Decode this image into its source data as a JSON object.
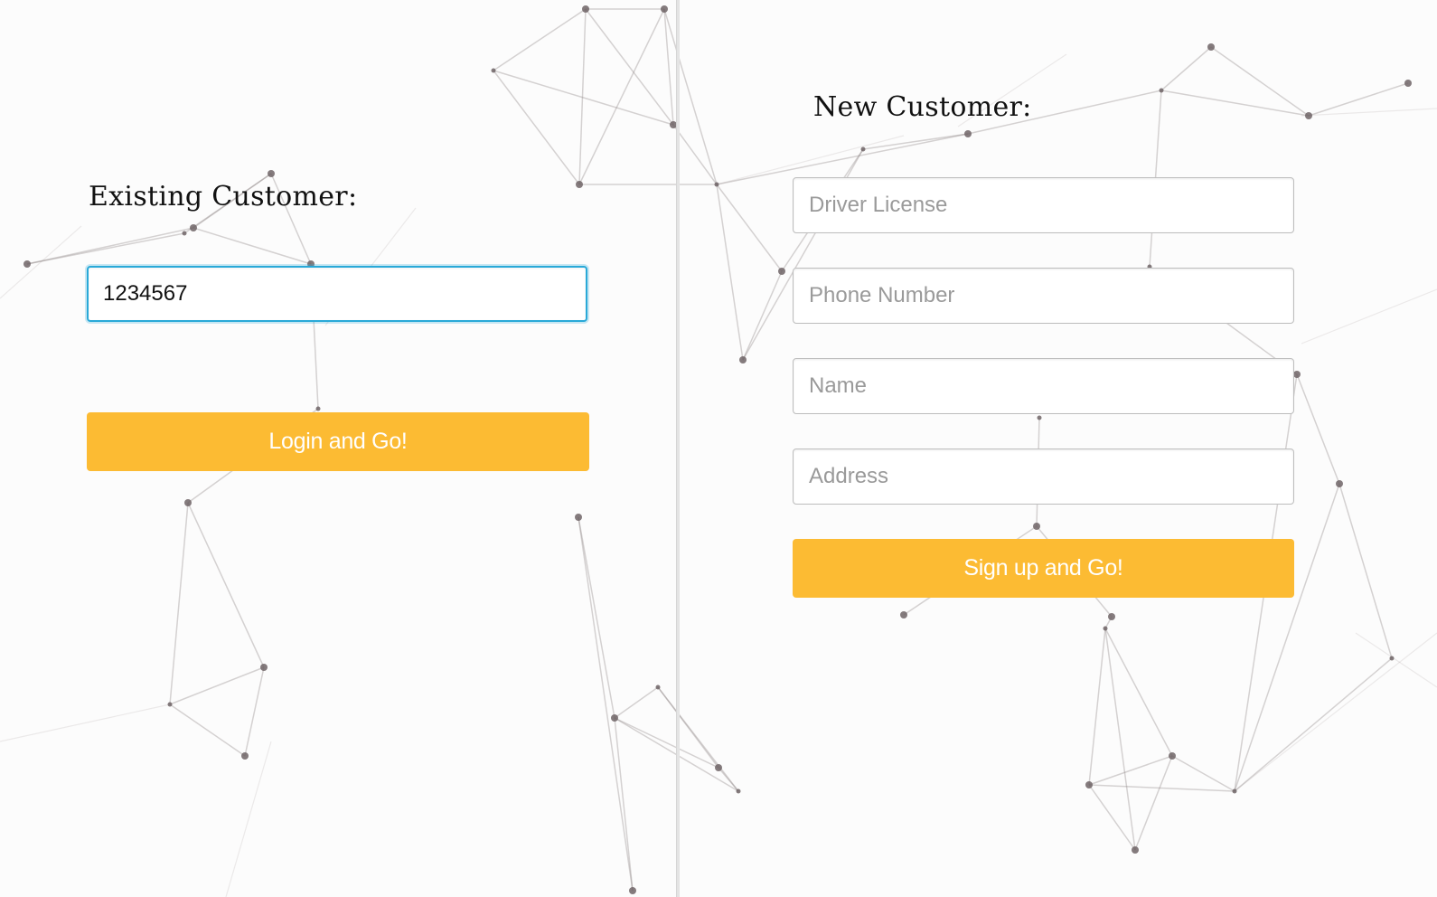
{
  "existing_customer": {
    "heading": "Existing Customer:",
    "id_input": {
      "value": "1234567",
      "placeholder": ""
    },
    "login_button_label": "Login and Go!"
  },
  "new_customer": {
    "heading": "New Customer:",
    "fields": {
      "driver_license_placeholder": "Driver License",
      "phone_number_placeholder": "Phone Number",
      "name_placeholder": "Name",
      "address_placeholder": "Address"
    },
    "signup_button_label": "Sign up and Go!"
  },
  "colors": {
    "background": "#fcfcfc",
    "accent_button": "#fcbb33",
    "focus_ring": "#29a9d8",
    "network_line": "#8a8082",
    "network_node": "#6e6466"
  },
  "background_graphic": "network-mesh-pattern"
}
